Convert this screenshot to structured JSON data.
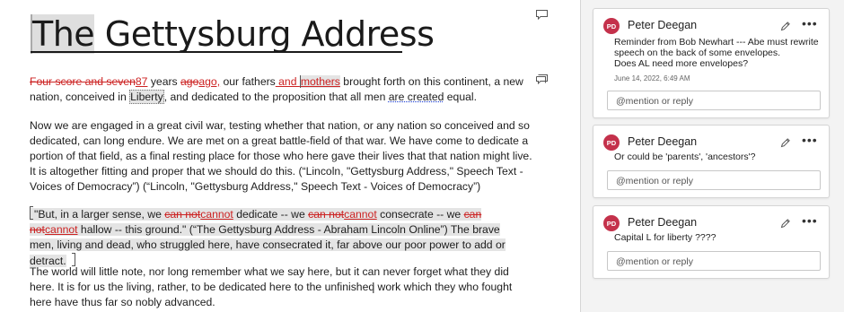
{
  "document": {
    "title_first": "The",
    "title_rest": " Gettysburg Address",
    "p1": {
      "del1": "Four score and seven",
      "ins1": "87",
      "t1": " years ",
      "del2": "ago",
      "ins2": "ago,",
      "t2": " our fathers",
      "ins3": " and ",
      "ins4": "mothers",
      "t3": " brought forth on this continent, a new nation, conceived in ",
      "liberty": "Liberty",
      "t4": ", and dedicated to the proposition that all men ",
      "are_created": "are created",
      "t5": " equal."
    },
    "p2": "Now we are engaged in a great civil war, testing whether that nation, or any nation so conceived and so dedicated, can long endure. We are met on a great battle-field of that war. We have come to dedicate a portion of that field, as a final resting place for those who here gave their lives that that nation might live. It is altogether fitting and proper that we should do this. (“Lincoln, \"Gettysburg Address,\" Speech Text - Voices of Democracy”) (“Lincoln, \"Gettysburg Address,\" Speech Text - Voices of Democracy”)",
    "p3": {
      "t1": "\"But, in a larger sense, we ",
      "del1": "can not",
      "ins1": "cannot",
      "t2": " dedicate -- we ",
      "del2": "can not",
      "ins2": "cannot",
      "t3": " consecrate -- we ",
      "del3": "can not",
      "ins3": "cannot",
      "t4": " hallow -- this ground.\" (“The Gettysburg Address - Abraham Lincoln Online”)",
      "t5": " The brave men, living and dead, who struggled here, have consecrated it, far above our poor power to add or detract."
    },
    "p4": "The world will little note, nor long remember what we say here, but it can never forget what they did here. It is for us the living, rather, to be dedicated here to the unfinished work which they who fought here have thus far so nobly advanced."
  },
  "comments": [
    {
      "initials": "PD",
      "author": "Peter Deegan",
      "text": "Reminder from Bob Newhart --- Abe must rewrite speech on the back of some envelopes.\nDoes AL need more envelopes?",
      "date": "June 14, 2022, 6:49 AM",
      "reply_placeholder": "@mention or reply"
    },
    {
      "initials": "PD",
      "author": "Peter Deegan",
      "text": "Or could be 'parents', 'ancestors'?",
      "reply_placeholder": "@mention or reply"
    },
    {
      "initials": "PD",
      "author": "Peter Deegan",
      "text": "Capital L for liberty ????",
      "reply_placeholder": "@mention or reply"
    }
  ],
  "more_label": "•••",
  "colors": {
    "tracked_change": "#cc2222",
    "avatar": "#c4314b",
    "pane_bg": "#f3f3f3"
  },
  "icons": [
    "comment-marker-icon",
    "pencil-icon",
    "more-options-icon",
    "text-cursor-icon"
  ]
}
